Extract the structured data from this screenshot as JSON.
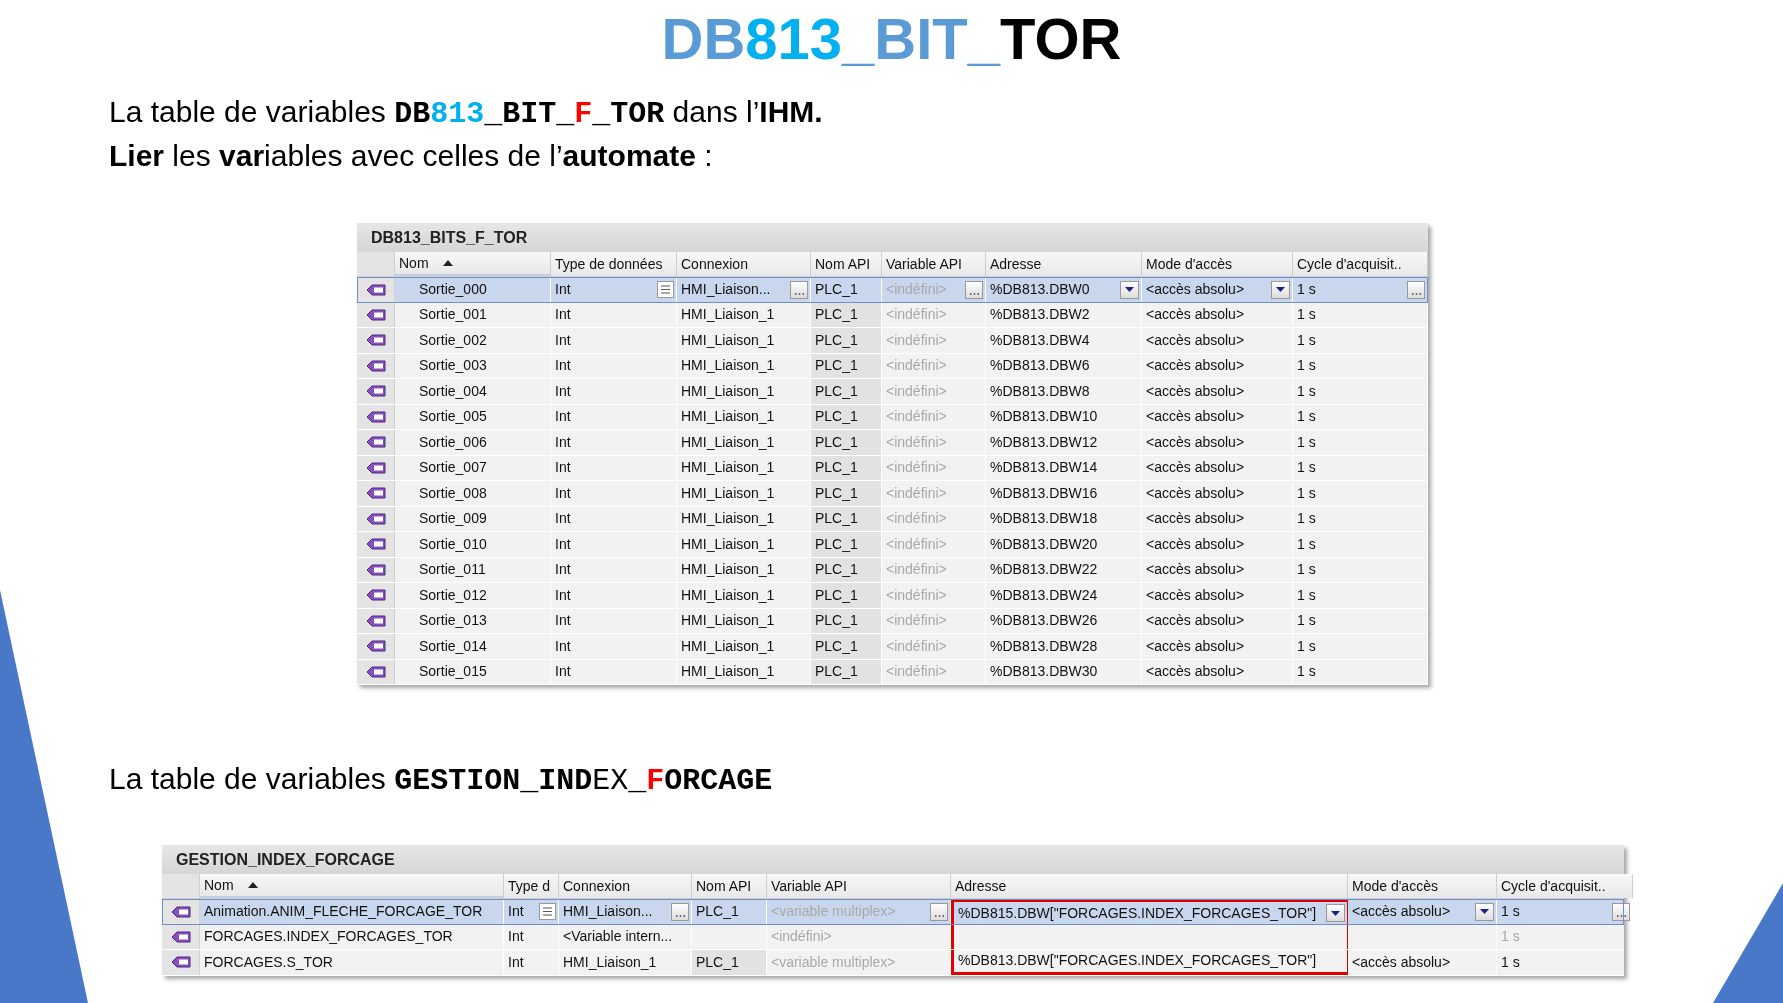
{
  "title": [
    {
      "text": "DB",
      "kind": "steel"
    },
    {
      "text": "813",
      "kind": "cyan"
    },
    {
      "text": "_BIT_",
      "kind": "steel"
    },
    {
      "text": "TOR",
      "kind": "plain"
    }
  ],
  "intro": [
    [
      {
        "text": "La table de variables ",
        "kind": "plain",
        "bold": false,
        "mono": false
      },
      {
        "text": "DB",
        "kind": "plain",
        "bold": true,
        "mono": true
      },
      {
        "text": "813",
        "kind": "cyan",
        "bold": true,
        "mono": true
      },
      {
        "text": "_BIT_",
        "kind": "plain",
        "bold": true,
        "mono": true
      },
      {
        "text": "F",
        "kind": "red",
        "bold": true,
        "mono": true
      },
      {
        "text": "_TOR",
        "kind": "plain",
        "bold": true,
        "mono": true
      },
      {
        "text": " dans l’",
        "kind": "plain",
        "bold": false,
        "mono": false
      },
      {
        "text": "IHM.",
        "kind": "plain",
        "bold": true,
        "mono": false
      }
    ],
    [
      {
        "text": "Lier",
        "kind": "plain",
        "bold": true,
        "mono": false
      },
      {
        "text": " les ",
        "kind": "plain",
        "bold": false,
        "mono": false
      },
      {
        "text": "var",
        "kind": "plain",
        "bold": true,
        "mono": false
      },
      {
        "text": "iables avec celles de l’",
        "kind": "plain",
        "bold": false,
        "mono": false
      },
      {
        "text": "automate",
        "kind": "plain",
        "bold": true,
        "mono": false
      },
      {
        "text": " :",
        "kind": "plain",
        "bold": false,
        "mono": false
      }
    ]
  ],
  "tables": [
    {
      "caption": "DB813_BITS_F_TOR",
      "columns": [
        {
          "label": "Nom",
          "sorted": true,
          "highlighted": false
        },
        {
          "label": "Type de données",
          "sorted": false,
          "highlighted": false
        },
        {
          "label": "Connexion",
          "sorted": false,
          "highlighted": false
        },
        {
          "label": "Nom API",
          "sorted": false,
          "highlighted": false
        },
        {
          "label": "Variable API",
          "sorted": false,
          "highlighted": false
        },
        {
          "label": "Adresse",
          "sorted": false,
          "highlighted": false
        },
        {
          "label": "Mode d'accès",
          "sorted": false,
          "highlighted": false
        },
        {
          "label": "Cycle d'acquisit..",
          "sorted": false,
          "highlighted": false
        }
      ],
      "rows": [
        {
          "selected": true,
          "disabled": false,
          "cells": [
            "Sortie_000",
            "Int",
            "HMI_Liaison...",
            "PLC_1",
            "<indéfini>",
            "%DB813.DBW0",
            "<accès absolu>",
            "1 s"
          ]
        },
        {
          "selected": false,
          "disabled": false,
          "cells": [
            "Sortie_001",
            "Int",
            "HMI_Liaison_1",
            "PLC_1",
            "<indéfini>",
            "%DB813.DBW2",
            "<accès absolu>",
            "1 s"
          ]
        },
        {
          "selected": false,
          "disabled": false,
          "cells": [
            "Sortie_002",
            "Int",
            "HMI_Liaison_1",
            "PLC_1",
            "<indéfini>",
            "%DB813.DBW4",
            "<accès absolu>",
            "1 s"
          ]
        },
        {
          "selected": false,
          "disabled": false,
          "cells": [
            "Sortie_003",
            "Int",
            "HMI_Liaison_1",
            "PLC_1",
            "<indéfini>",
            "%DB813.DBW6",
            "<accès absolu>",
            "1 s"
          ]
        },
        {
          "selected": false,
          "disabled": false,
          "cells": [
            "Sortie_004",
            "Int",
            "HMI_Liaison_1",
            "PLC_1",
            "<indéfini>",
            "%DB813.DBW8",
            "<accès absolu>",
            "1 s"
          ]
        },
        {
          "selected": false,
          "disabled": false,
          "cells": [
            "Sortie_005",
            "Int",
            "HMI_Liaison_1",
            "PLC_1",
            "<indéfini>",
            "%DB813.DBW10",
            "<accès absolu>",
            "1 s"
          ]
        },
        {
          "selected": false,
          "disabled": false,
          "cells": [
            "Sortie_006",
            "Int",
            "HMI_Liaison_1",
            "PLC_1",
            "<indéfini>",
            "%DB813.DBW12",
            "<accès absolu>",
            "1 s"
          ]
        },
        {
          "selected": false,
          "disabled": false,
          "cells": [
            "Sortie_007",
            "Int",
            "HMI_Liaison_1",
            "PLC_1",
            "<indéfini>",
            "%DB813.DBW14",
            "<accès absolu>",
            "1 s"
          ]
        },
        {
          "selected": false,
          "disabled": false,
          "cells": [
            "Sortie_008",
            "Int",
            "HMI_Liaison_1",
            "PLC_1",
            "<indéfini>",
            "%DB813.DBW16",
            "<accès absolu>",
            "1 s"
          ]
        },
        {
          "selected": false,
          "disabled": false,
          "cells": [
            "Sortie_009",
            "Int",
            "HMI_Liaison_1",
            "PLC_1",
            "<indéfini>",
            "%DB813.DBW18",
            "<accès absolu>",
            "1 s"
          ]
        },
        {
          "selected": false,
          "disabled": false,
          "cells": [
            "Sortie_010",
            "Int",
            "HMI_Liaison_1",
            "PLC_1",
            "<indéfini>",
            "%DB813.DBW20",
            "<accès absolu>",
            "1 s"
          ]
        },
        {
          "selected": false,
          "disabled": false,
          "cells": [
            "Sortie_011",
            "Int",
            "HMI_Liaison_1",
            "PLC_1",
            "<indéfini>",
            "%DB813.DBW22",
            "<accès absolu>",
            "1 s"
          ]
        },
        {
          "selected": false,
          "disabled": false,
          "cells": [
            "Sortie_012",
            "Int",
            "HMI_Liaison_1",
            "PLC_1",
            "<indéfini>",
            "%DB813.DBW24",
            "<accès absolu>",
            "1 s"
          ]
        },
        {
          "selected": false,
          "disabled": false,
          "cells": [
            "Sortie_013",
            "Int",
            "HMI_Liaison_1",
            "PLC_1",
            "<indéfini>",
            "%DB813.DBW26",
            "<accès absolu>",
            "1 s"
          ]
        },
        {
          "selected": false,
          "disabled": false,
          "cells": [
            "Sortie_014",
            "Int",
            "HMI_Liaison_1",
            "PLC_1",
            "<indéfini>",
            "%DB813.DBW28",
            "<accès absolu>",
            "1 s"
          ]
        },
        {
          "selected": false,
          "disabled": false,
          "cells": [
            "Sortie_015",
            "Int",
            "HMI_Liaison_1",
            "PLC_1",
            "<indéfini>",
            "%DB813.DBW30",
            "<accès absolu>",
            "1 s"
          ]
        }
      ]
    },
    {
      "heading": [
        {
          "text": "La table de variables ",
          "kind": "plain",
          "bold": false,
          "mono": false
        },
        {
          "text": "GESTION_IND",
          "kind": "plain",
          "bold": true,
          "mono": true
        },
        {
          "text": "EX_",
          "kind": "plain",
          "bold": false,
          "mono": true
        },
        {
          "text": "F",
          "kind": "red",
          "bold": true,
          "mono": true
        },
        {
          "text": "ORCAGE",
          "kind": "plain",
          "bold": true,
          "mono": true
        }
      ],
      "caption": "GESTION_INDEX_FORCAGE",
      "columns": [
        {
          "label": "Nom",
          "sorted": true,
          "highlighted": false
        },
        {
          "label": "Type d",
          "sorted": false,
          "highlighted": false
        },
        {
          "label": "Connexion",
          "sorted": false,
          "highlighted": false
        },
        {
          "label": "Nom API",
          "sorted": false,
          "highlighted": false
        },
        {
          "label": "Variable API",
          "sorted": false,
          "highlighted": false
        },
        {
          "label": "Adresse",
          "sorted": false,
          "highlighted": true
        },
        {
          "label": "Mode d'accès",
          "sorted": false,
          "highlighted": false
        },
        {
          "label": "Cycle d'acquisit..",
          "sorted": false,
          "highlighted": false
        }
      ],
      "rows": [
        {
          "selected": true,
          "disabled": false,
          "cells": [
            "Animation.ANIM_FLECHE_FORCAGE_TOR",
            "Int",
            "HMI_Liaison...",
            "PLC_1",
            "<variable multiplex>",
            "%DB815.DBW[\"FORCAGES.INDEX_FORCAGES_TOR\"]",
            "<accès absolu>",
            "1 s"
          ]
        },
        {
          "selected": false,
          "disabled": true,
          "cells": [
            "FORCAGES.INDEX_FORCAGES_TOR",
            "Int",
            "<Variable intern...",
            "",
            "<indéfini>",
            "",
            "",
            "1 s"
          ]
        },
        {
          "selected": false,
          "disabled": false,
          "cells": [
            "FORCAGES.S_TOR",
            "Int",
            "HMI_Liaison_1",
            "PLC_1",
            "<variable multiplex>",
            "%DB813.DBW[\"FORCAGES.INDEX_FORCAGES_TOR\"]",
            "<accès absolu>",
            "1 s"
          ]
        }
      ]
    }
  ]
}
